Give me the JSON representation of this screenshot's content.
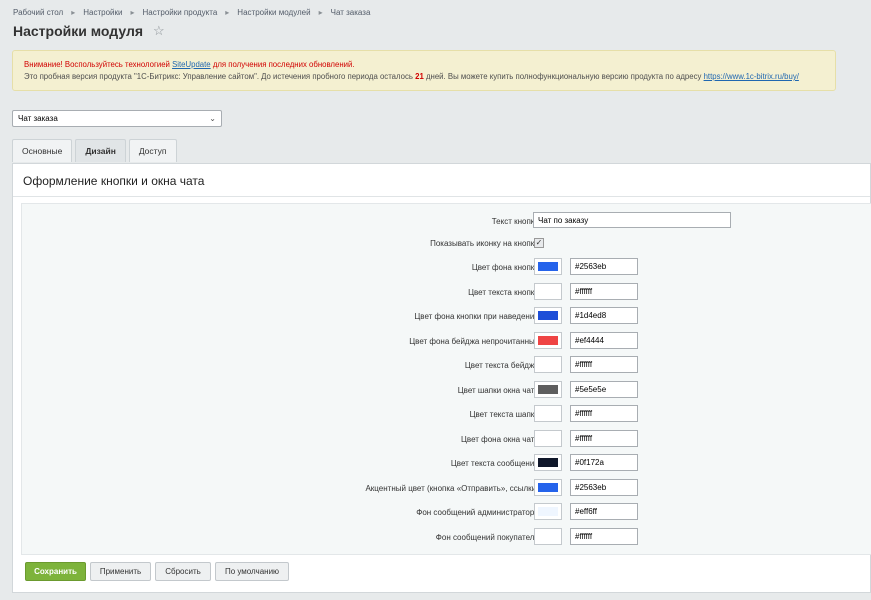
{
  "breadcrumb": [
    "Рабочий стол",
    "Настройки",
    "Настройки продукта",
    "Настройки модулей",
    "Чат заказа"
  ],
  "page_title": "Настройки модуля",
  "notice": {
    "line1_prefix": "Внимание! Воспользуйтесь технологией",
    "line1_link": "SiteUpdate",
    "line1_suffix": "для получения последних обновлений.",
    "line2_prefix": "Это пробная версия продукта \"1С-Битрикс: Управление сайтом\". До истечения пробного периода осталось",
    "line2_days": "21",
    "line2_middle": "дней. Вы можете купить полнофункциональную версию продукта по адресу",
    "line2_link": "https://www.1c-bitrix.ru/buy/"
  },
  "module_select": {
    "value": "Чат заказа"
  },
  "tabs": [
    {
      "label": "Основные"
    },
    {
      "label": "Дизайн"
    },
    {
      "label": "Доступ"
    }
  ],
  "section_title": "Оформление кнопки и окна чата",
  "button_text": {
    "label": "Текст кнопки:",
    "value": "Чат по заказу"
  },
  "show_icon": {
    "label": "Показывать иконку на кнопке:",
    "checked": true,
    "mark": "✓"
  },
  "color_fields": [
    {
      "label": "Цвет фона кнопки:",
      "value": "#2563eb"
    },
    {
      "label": "Цвет текста кнопки:",
      "value": "#ffffff"
    },
    {
      "label": "Цвет фона кнопки при наведении:",
      "value": "#1d4ed8"
    },
    {
      "label": "Цвет фона бейджа непрочитанных:",
      "value": "#ef4444"
    },
    {
      "label": "Цвет текста бейджа:",
      "value": "#ffffff"
    },
    {
      "label": "Цвет шапки окна чата:",
      "value": "#5e5e5e"
    },
    {
      "label": "Цвет текста шапки:",
      "value": "#ffffff"
    },
    {
      "label": "Цвет фона окна чата:",
      "value": "#ffffff"
    },
    {
      "label": "Цвет текста сообщений:",
      "value": "#0f172a"
    },
    {
      "label": "Акцентный цвет (кнопка «Отправить», ссылки):",
      "value": "#2563eb"
    },
    {
      "label": "Фон сообщений администратора:",
      "value": "#eff6ff"
    },
    {
      "label": "Фон сообщений покупателя:",
      "value": "#ffffff"
    }
  ],
  "buttons": {
    "save": "Сохранить",
    "apply": "Применить",
    "reset": "Сбросить",
    "default": "По умолчанию"
  }
}
